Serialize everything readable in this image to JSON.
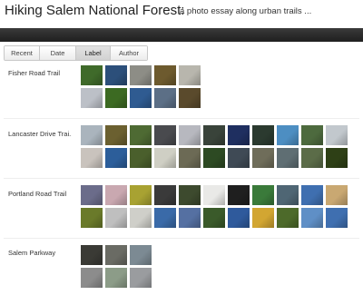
{
  "header": {
    "title": "Hiking Salem National Forest:",
    "subtitle": "a photo essay along urban trails ..."
  },
  "tabs": [
    "Recent",
    "Date",
    "Label",
    "Author"
  ],
  "active_tab": "Label",
  "sections": [
    {
      "label": "Fisher Road Trail",
      "photos": [
        "#3f6a2a",
        "#2c4f7a",
        "#8d8d86",
        "#6d5a2e",
        "#b8b6ad",
        "#bcc0c7",
        "#3c6a22",
        "#2f5b91",
        "#5c6f86",
        "#5a4a2c"
      ]
    },
    {
      "label": "Lancaster Drive Trai...",
      "photos": [
        "#aab4bd",
        "#6b6030",
        "#4e6a33",
        "#494a4e",
        "#b7b8bf",
        "#39433a",
        "#1f2f60",
        "#2b3a2f",
        "#4d8ec2",
        "#4d6a3e",
        "#c2c8cd",
        "#c9c3bd",
        "#2c5e9a",
        "#4a5f2c",
        "#cfcfc4",
        "#6c6a55",
        "#2d4a23",
        "#3f4a55",
        "#6f6d5a",
        "#5f6e73",
        "#5b6c48",
        "#2e4016"
      ]
    },
    {
      "label": "Portland Road Trail",
      "photos": [
        "#6b6c8a",
        "#c9a8b0",
        "#a8a232",
        "#3a3a3a",
        "#3d4a2e",
        "#e9e9e7",
        "#1f1f1f",
        "#3a7a3a",
        "#4f6674",
        "#3f6fb0",
        "#c9a872",
        "#6a7a2a",
        "#bfbfbf",
        "#cfcfc9",
        "#3a6aa8",
        "#5570a2",
        "#3a5a2a",
        "#2f5a9c",
        "#d2a632",
        "#4d6a2a",
        "#5f8fc6",
        "#3f6fb0"
      ]
    },
    {
      "label": "Salem Parkway",
      "photos": [
        "#3a3a35",
        "#6a6b64",
        "#7c8a93",
        "#8c8c8c",
        "#8c9c88",
        "#9a9c9f"
      ]
    }
  ]
}
